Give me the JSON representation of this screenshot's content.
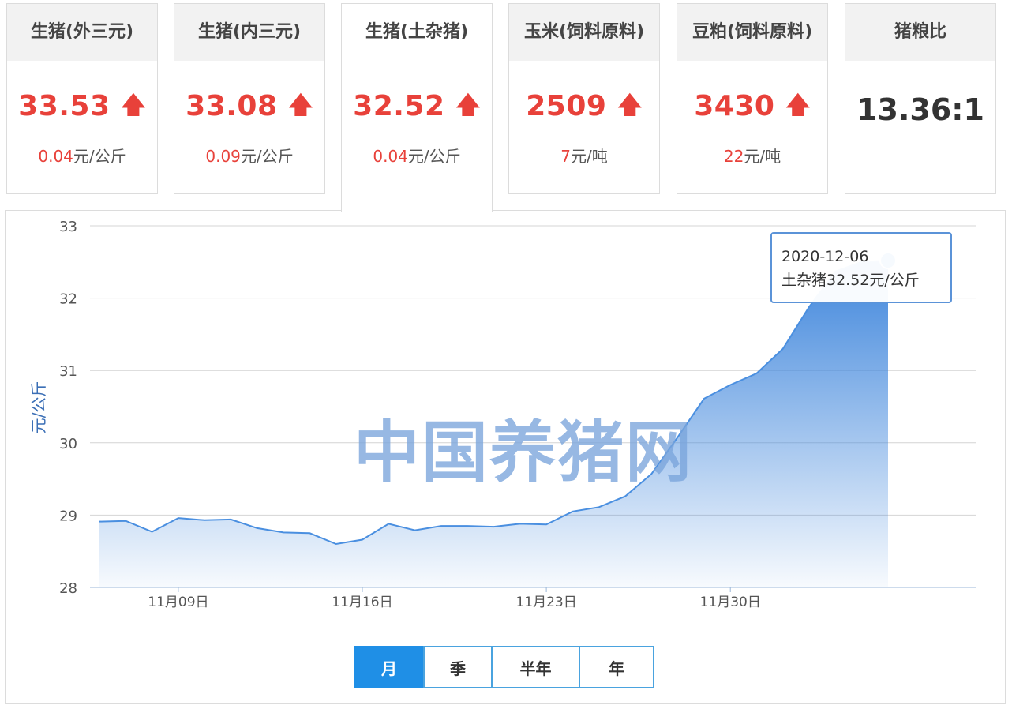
{
  "cards": [
    {
      "title": "生猪(外三元)",
      "price": "33.53",
      "change": "0.04",
      "unit": "元/公斤"
    },
    {
      "title": "生猪(内三元)",
      "price": "33.08",
      "change": "0.09",
      "unit": "元/公斤"
    },
    {
      "title": "生猪(土杂猪)",
      "price": "32.52",
      "change": "0.04",
      "unit": "元/公斤"
    },
    {
      "title": "玉米(饲料原料)",
      "price": "2509",
      "change": "7",
      "unit": "元/吨"
    },
    {
      "title": "豆粕(饲料原料)",
      "price": "3430",
      "change": "22",
      "unit": "元/吨"
    },
    {
      "title": "猪粮比",
      "ratio": "13.36:1"
    }
  ],
  "arrow_glyph": "🡅",
  "watermark": "中国养猪网",
  "tooltip": {
    "date": "2020-12-06",
    "text": "土杂猪32.52元/公斤"
  },
  "range_tabs": [
    "月",
    "季",
    "半年",
    "年"
  ],
  "colors": {
    "up": "#e8413a",
    "line": "#4a8fe0",
    "accent": "#1f8fe6"
  },
  "chart_data": {
    "type": "area",
    "ylabel": "元/公斤",
    "ylim": [
      28,
      33
    ],
    "y_ticks": [
      "28",
      "29",
      "30",
      "31",
      "32",
      "33"
    ],
    "x_tick_labels": [
      "11月09日",
      "11月16日",
      "11月23日",
      "11月30日"
    ],
    "x_tick_days": [
      3,
      10,
      17,
      24
    ],
    "grid": true,
    "series": [
      {
        "values": [
          28.91,
          28.92,
          28.77,
          28.96,
          28.93,
          28.94,
          28.82,
          28.76,
          28.75,
          28.6,
          28.66,
          28.88,
          28.79,
          28.85,
          28.85,
          28.84,
          28.88,
          28.87,
          29.05,
          29.11,
          29.26,
          29.57,
          30.08,
          30.61,
          30.8,
          30.96,
          31.3,
          31.88,
          32.37,
          32.5,
          32.52
        ]
      }
    ]
  }
}
